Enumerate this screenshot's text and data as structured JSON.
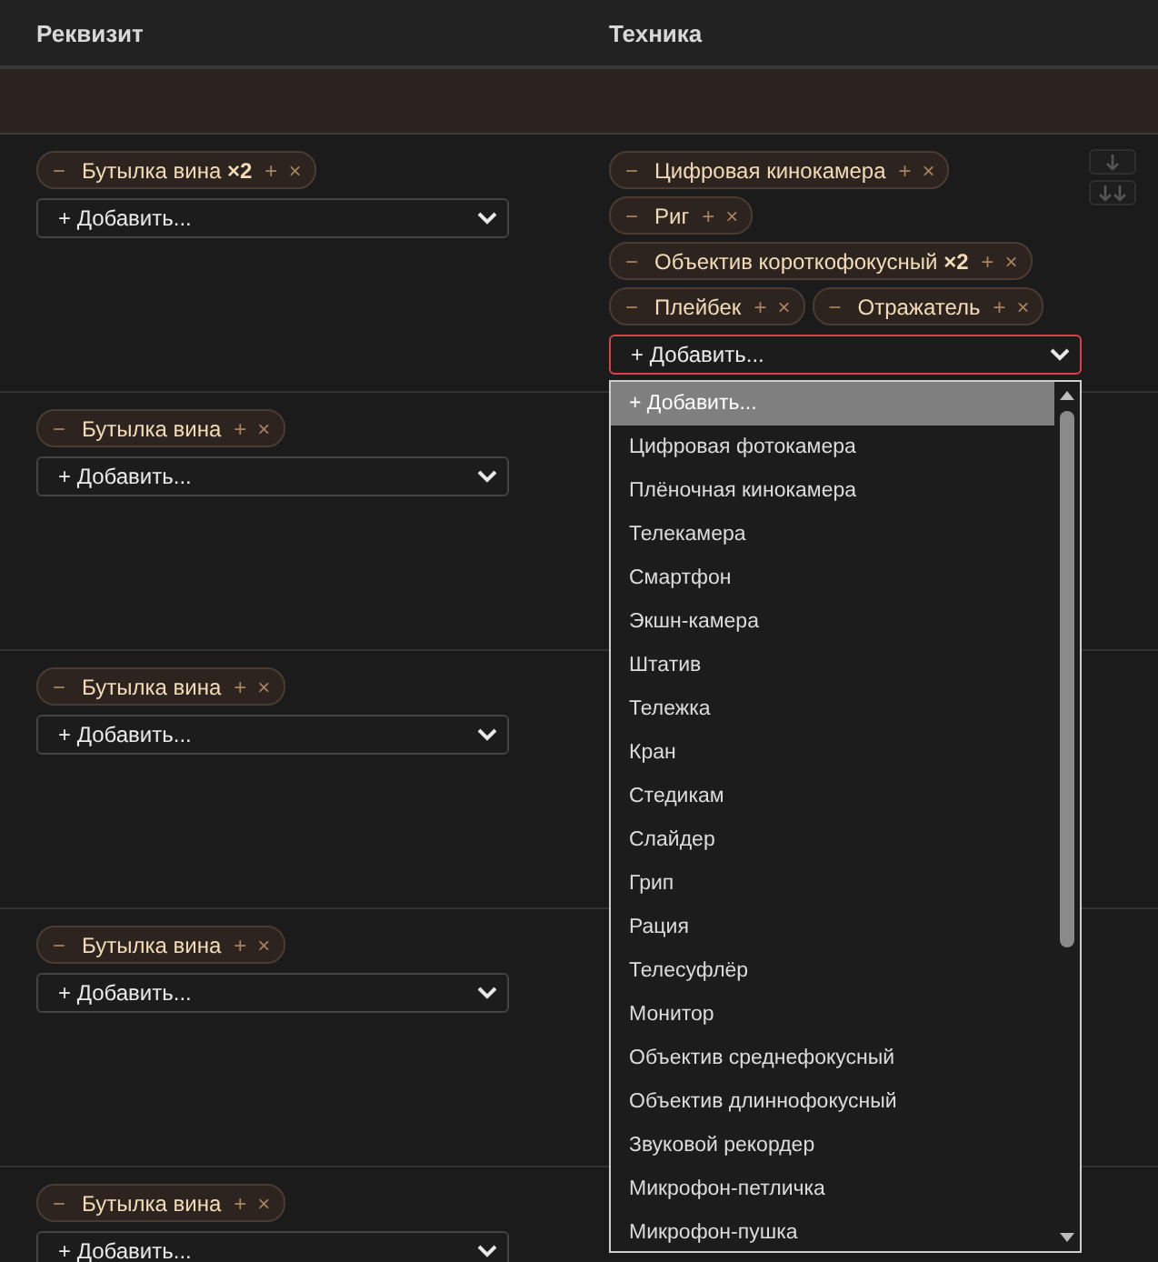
{
  "columns": [
    "Реквизит",
    "Техника"
  ],
  "rows": [
    {
      "hovered": true,
      "props": {
        "chips": [
          "Бутылка вина **×2**"
        ],
        "select": {
          "value": "+ Добавить...",
          "open": false
        }
      },
      "tech": {
        "chips": [
          "Цифровая кинокамера",
          "Риг",
          "Объектив короткофокусный **×2**",
          "Плейбек",
          "Отражатель"
        ],
        "select": {
          "value": "+ Добавить...",
          "open": true
        }
      }
    },
    {
      "hovered": false,
      "props": {
        "chips": [
          "Бутылка вина"
        ],
        "select": {
          "value": "+ Добавить...",
          "open": false
        }
      }
    },
    {
      "hovered": false,
      "props": {
        "chips": [
          "Бутылка вина"
        ],
        "select": {
          "value": "+ Добавить...",
          "open": false
        }
      }
    },
    {
      "hovered": false,
      "props": {
        "chips": [
          "Бутылка вина"
        ],
        "select": {
          "value": "+ Добавить...",
          "open": false
        }
      }
    },
    {
      "hovered": false,
      "props": {
        "chips": [
          "Бутылка вина"
        ],
        "select": {
          "value": "+ Добавить...",
          "open": false
        }
      }
    }
  ],
  "chip_buttons": {
    "decrease": "−",
    "increase": "+",
    "remove": "×"
  },
  "dropdown_options": [
    {
      "label": "+ Добавить...",
      "selected": true
    },
    {
      "label": "Цифровая фотокамера",
      "selected": false
    },
    {
      "label": "Плёночная кинокамера",
      "selected": false
    },
    {
      "label": "Телекамера",
      "selected": false
    },
    {
      "label": "Смартфон",
      "selected": false
    },
    {
      "label": "Экшн-камера",
      "selected": false
    },
    {
      "label": "Штатив",
      "selected": false
    },
    {
      "label": "Тележка",
      "selected": false
    },
    {
      "label": "Кран",
      "selected": false
    },
    {
      "label": "Стедикам",
      "selected": false
    },
    {
      "label": "Слайдер",
      "selected": false
    },
    {
      "label": "Грип",
      "selected": false
    },
    {
      "label": "Рация",
      "selected": false
    },
    {
      "label": "Телесуфлёр",
      "selected": false
    },
    {
      "label": "Монитор",
      "selected": false
    },
    {
      "label": "Объектив среднефокусный",
      "selected": false
    },
    {
      "label": "Объектив длиннофокусный",
      "selected": false
    },
    {
      "label": "Звуковой рекордер",
      "selected": false
    },
    {
      "label": "Микрофон-петличка",
      "selected": false
    },
    {
      "label": "Микрофон-пушка",
      "selected": false
    }
  ]
}
